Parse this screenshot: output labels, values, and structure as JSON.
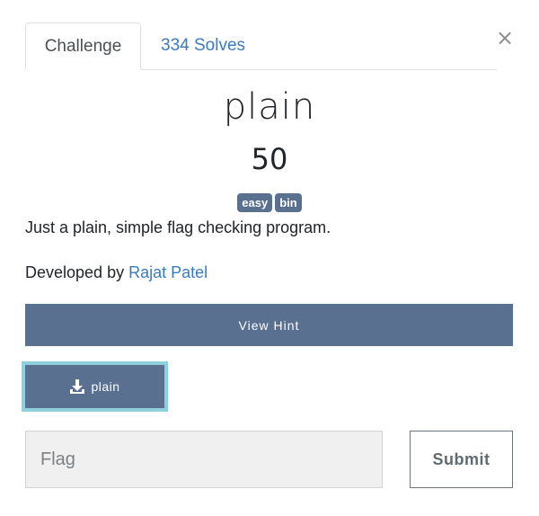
{
  "tabs": [
    {
      "label": "Challenge",
      "active": true
    },
    {
      "label": "334 Solves",
      "active": false
    }
  ],
  "close_label": "×",
  "challenge": {
    "name": "plain",
    "value": "50",
    "tags": [
      "easy",
      "bin"
    ],
    "description": "Just a plain, simple flag checking program.",
    "developer_prefix": "Developed by ",
    "developer_name": "Rajat Patel"
  },
  "hint_button": "View Hint",
  "file_button": {
    "label": "plain",
    "icon": "download-icon"
  },
  "flag_input": {
    "value": "",
    "placeholder": "Flag"
  },
  "submit_label": "Submit",
  "colors": {
    "accent": "#5a7090",
    "link": "#3a7bbf",
    "focus_ring": "#8ed0dc"
  }
}
